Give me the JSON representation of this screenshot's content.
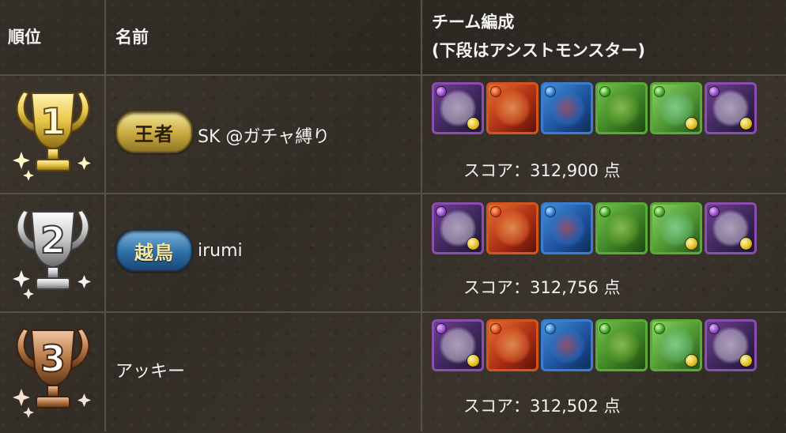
{
  "header": {
    "rank": "順位",
    "name": "名前",
    "team_line1": "チーム編成",
    "team_line2": "(下段はアシストモンスター)"
  },
  "rows": [
    {
      "rank": "1",
      "trophy": "gold-trophy-icon",
      "badge": "王者",
      "badge_style": "gold",
      "name": "SK @ガチャ縛り",
      "score_prefix": "スコア：",
      "score": "312,900",
      "score_unit": "点"
    },
    {
      "rank": "2",
      "trophy": "silver-trophy-icon",
      "badge": "越鳥",
      "badge_style": "blue",
      "name": "irumi",
      "score_prefix": "スコア：",
      "score": "312,756",
      "score_unit": "点"
    },
    {
      "rank": "3",
      "trophy": "bronze-trophy-icon",
      "badge": "",
      "badge_style": "none",
      "name": "アッキー",
      "score_prefix": "スコア：",
      "score": "312,502",
      "score_unit": "点"
    }
  ],
  "team_icons": [
    "dark-attribute-monster-icon",
    "fire-attribute-monster-icon",
    "water-attribute-monster-icon",
    "wood-attribute-monster-icon",
    "wood-attribute-monster-icon",
    "dark-attribute-monster-icon"
  ],
  "colors": {
    "background": "#3a342c",
    "grid": "#55504a",
    "text": "#f2f2f2",
    "gold": "#e8c64a",
    "silver": "#d8d8d8",
    "bronze": "#b67a4a"
  }
}
